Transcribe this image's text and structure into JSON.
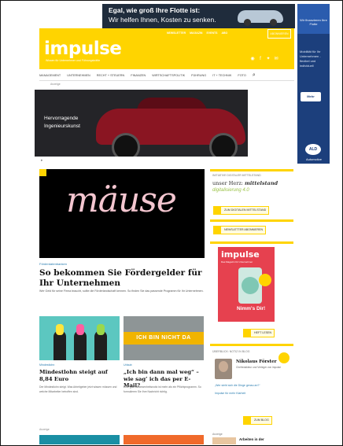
{
  "top_ad": {
    "line1": "Egal, wie groß Ihre Flotte ist:",
    "line2": "Wir helfen Ihnen, Kosten zu senken."
  },
  "sky_ad": {
    "top": "Wir finanzieren Ihre Flotte",
    "text": "Mobilität für Ihr Unternehmen - flexibel und individuell",
    "button": "Mehr",
    "logo": "ALD",
    "logo_text": "Automotive"
  },
  "header": {
    "logo": "impulse",
    "tagline": "Wissen für Unternehmer und Führungskräfte",
    "top_links": [
      "NEWSLETTER",
      "MAGAZIN",
      "EVENTS",
      "ABO"
    ],
    "abo_button": "ABONNIEREN"
  },
  "nav": {
    "items": [
      "Management",
      "Unternehmen",
      "Recht + Steuern",
      "Finanzen",
      "Wirtschaftspolitik",
      "Führung",
      "IT + Technik",
      "Foto"
    ]
  },
  "ad_label": "Anzeige",
  "car_ad": {
    "line1": "Hervorragende",
    "line2": "Ingenieurskunst"
  },
  "main": {
    "hero_word": "mäuse",
    "kicker": "Förderdatenbanken",
    "headline": "So bekommen Sie Fördergelder für Ihr Unternehmen",
    "teaser": "Wer Geld für seine Firma braucht, sollte die Förderlandschaft kennen. So finden Sie das passende Programm für Ihr Unternehmen."
  },
  "cards": [
    {
      "kicker": "Mindestlohn",
      "title": "Mindestlohn steigt auf 8,84 Euro",
      "teaser": "Der Mindestlohn steigt. Was Arbeitgeber jetzt wissen müssen und welche Mitarbeiter betroffen sind."
    },
    {
      "image_text": "ICH BIN NICHT DA",
      "kicker": "Urlaub",
      "title": "„Ich bin dann mal weg“ – wie sag’ ich das per E-Mail?",
      "teaser": "Eine gute Abwesenheitsnotiz ist mehr als ein Pflichtprogramm. So formulieren Sie Ihre Nachricht richtig."
    }
  ],
  "bottom_label": "Anzeige",
  "sidebar": {
    "box1": {
      "label": "INITIATIVE DIGITALER MITTELSTAND",
      "mittelstand_prefix": "unser Herz: ",
      "mittelstand": "mittelstand",
      "digital": "digitalisierung 4.0",
      "button": "ZUM DIGITALEN MITTELSTAND"
    },
    "box2": {
      "button": "NEWSLETTER ABONNIEREN"
    },
    "magazine": {
      "logo": "impulse",
      "line": "Das Magazin für Unternehmer",
      "title": "Nimm's Dir!",
      "button": "HEFT LESEN"
    },
    "blog": {
      "label": "ÜBERBLICK: NOTIZ IN BLOG",
      "name": "Nikolaus Förster",
      "bio": "Chefredakteur und Verleger von impulse",
      "link1": "„Wer sieht sich die Dinge genau an?“",
      "link2": "Impulse für mehr Klarheit",
      "button": "ZUM BLOG"
    },
    "teaser": {
      "label": "Anzeige",
      "text": "Arbeiten in der"
    }
  },
  "colors": {
    "brand_yellow": "#ffd400",
    "link_blue": "#2a7db0",
    "ad_navy": "#1c3f7c"
  }
}
